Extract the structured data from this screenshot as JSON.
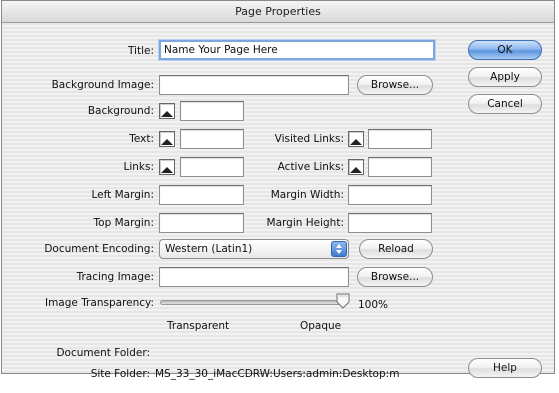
{
  "window": {
    "title": "Page Properties"
  },
  "fields": {
    "title": {
      "label": "Title:",
      "value": "Name Your Page Here"
    },
    "background_image": {
      "label": "Background Image:",
      "value": "",
      "browse_label": "Browse..."
    },
    "background": {
      "label": "Background:",
      "value": ""
    },
    "text": {
      "label": "Text:",
      "value": ""
    },
    "visited_links": {
      "label": "Visited Links:",
      "value": ""
    },
    "links": {
      "label": "Links:",
      "value": ""
    },
    "active_links": {
      "label": "Active Links:",
      "value": ""
    },
    "left_margin": {
      "label": "Left Margin:",
      "value": ""
    },
    "margin_width": {
      "label": "Margin Width:",
      "value": ""
    },
    "top_margin": {
      "label": "Top Margin:",
      "value": ""
    },
    "margin_height": {
      "label": "Margin Height:",
      "value": ""
    },
    "document_encoding": {
      "label": "Document Encoding:",
      "value": "Western (Latin1)",
      "reload_label": "Reload"
    },
    "tracing_image": {
      "label": "Tracing Image:",
      "value": "",
      "browse_label": "Browse..."
    },
    "image_transparency": {
      "label": "Image Transparency:",
      "value_percent": 100,
      "value_text": "100%",
      "min_label": "Transparent",
      "max_label": "Opaque"
    }
  },
  "folders": {
    "document_folder_label": "Document Folder:",
    "document_folder_value": "",
    "site_folder_label": "Site Folder:",
    "site_folder_value": "MS_33_30_iMacCDRW:Users:admin:Desktop:m"
  },
  "buttons": {
    "ok": "OK",
    "apply": "Apply",
    "cancel": "Cancel",
    "help": "Help"
  }
}
